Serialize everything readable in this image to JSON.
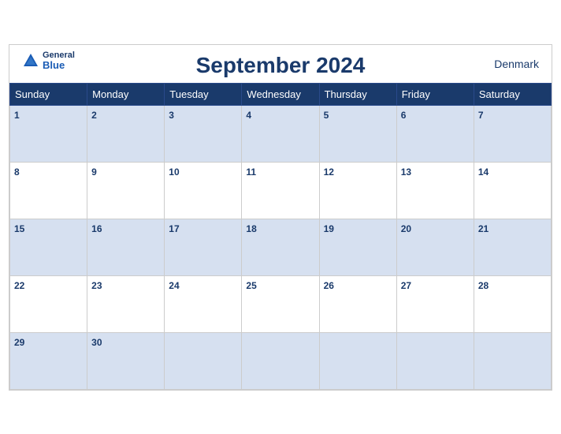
{
  "header": {
    "title": "September 2024",
    "country": "Denmark",
    "logo": {
      "general": "General",
      "blue": "Blue"
    }
  },
  "days_of_week": [
    "Sunday",
    "Monday",
    "Tuesday",
    "Wednesday",
    "Thursday",
    "Friday",
    "Saturday"
  ],
  "weeks": [
    {
      "shaded": true,
      "days": [
        1,
        2,
        3,
        4,
        5,
        6,
        7
      ]
    },
    {
      "shaded": false,
      "days": [
        8,
        9,
        10,
        11,
        12,
        13,
        14
      ]
    },
    {
      "shaded": true,
      "days": [
        15,
        16,
        17,
        18,
        19,
        20,
        21
      ]
    },
    {
      "shaded": false,
      "days": [
        22,
        23,
        24,
        25,
        26,
        27,
        28
      ]
    },
    {
      "shaded": true,
      "days": [
        29,
        30,
        null,
        null,
        null,
        null,
        null
      ]
    }
  ]
}
